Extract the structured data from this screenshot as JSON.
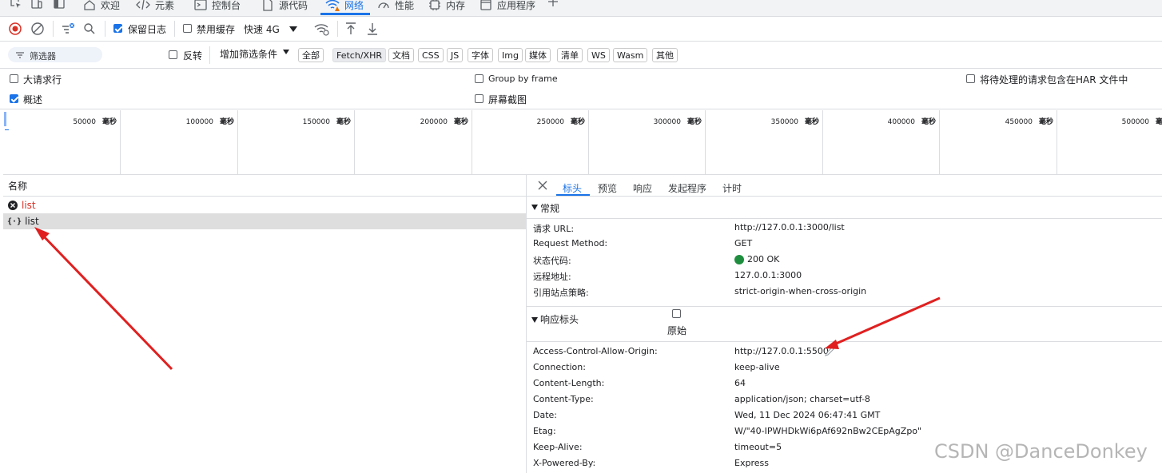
{
  "tabs": [
    {
      "label": "欢迎",
      "icon": "home-icon"
    },
    {
      "label": "元素",
      "icon": "code-icon"
    },
    {
      "label": "控制台",
      "icon": "console-icon"
    },
    {
      "label": "源代码",
      "icon": "sources-icon"
    },
    {
      "label": "网络",
      "icon": "wifi-warning-icon",
      "active": true
    },
    {
      "label": "性能",
      "icon": "performance-icon"
    },
    {
      "label": "内存",
      "icon": "memory-icon"
    },
    {
      "label": "应用程序",
      "icon": "application-icon"
    }
  ],
  "toolbar": {
    "preserve_log": "保留日志",
    "disable_cache": "禁用缓存",
    "throttle": "快速 4G"
  },
  "filter": {
    "placeholder": "筛选器",
    "invert": "反转",
    "more_filters": "增加筛选条件",
    "types": [
      "全部",
      "Fetch/XHR",
      "文档",
      "CSS",
      "JS",
      "字体",
      "Img",
      "媒体",
      "清单",
      "WS",
      "Wasm",
      "其他"
    ],
    "selected": "Fetch/XHR"
  },
  "options": {
    "large_rows": "大请求行",
    "overview": "概述",
    "group_by_frame": "Group by frame",
    "screenshots": "屏幕截图",
    "har": "将待处理的请求包含在HAR 文件中"
  },
  "timeline": {
    "ticks": [
      "50000",
      "100000",
      "150000",
      "200000",
      "250000",
      "300000",
      "350000",
      "400000",
      "450000",
      "500000"
    ],
    "unit": "毫秒"
  },
  "request_list": {
    "header": "名称",
    "rows": [
      {
        "name": "list",
        "status": "error"
      },
      {
        "name": "list",
        "status": "ok"
      }
    ]
  },
  "details": {
    "tabs": [
      "标头",
      "预览",
      "响应",
      "发起程序",
      "计时"
    ],
    "general": {
      "title": "常规",
      "rows": [
        {
          "k": "请求 URL:",
          "v": "http://127.0.0.1:3000/list"
        },
        {
          "k": "Request Method:",
          "v": "GET"
        },
        {
          "k": "状态代码:",
          "v": "200 OK"
        },
        {
          "k": "远程地址:",
          "v": "127.0.0.1:3000"
        },
        {
          "k": "引用站点策略:",
          "v": "strict-origin-when-cross-origin"
        }
      ]
    },
    "response_headers": {
      "title": "响应标头",
      "raw": "原始",
      "rows": [
        {
          "k": "Access-Control-Allow-Origin:",
          "v": "http://127.0.0.1:5500"
        },
        {
          "k": "Connection:",
          "v": "keep-alive"
        },
        {
          "k": "Content-Length:",
          "v": "64"
        },
        {
          "k": "Content-Type:",
          "v": "application/json; charset=utf-8"
        },
        {
          "k": "Date:",
          "v": "Wed, 11 Dec 2024 06:47:41 GMT"
        },
        {
          "k": "Etag:",
          "v": "W/\"40-IPWHDkWi6pAf692nBw2CEpAgZpo\""
        },
        {
          "k": "Keep-Alive:",
          "v": "timeout=5"
        },
        {
          "k": "X-Powered-By:",
          "v": "Express"
        }
      ]
    }
  },
  "watermark": "CSDN @DanceDonkey",
  "colors": {
    "accent": "#1a73e8",
    "error": "#d93025",
    "ok": "#1e8e3e",
    "annotation": "#e02020"
  }
}
